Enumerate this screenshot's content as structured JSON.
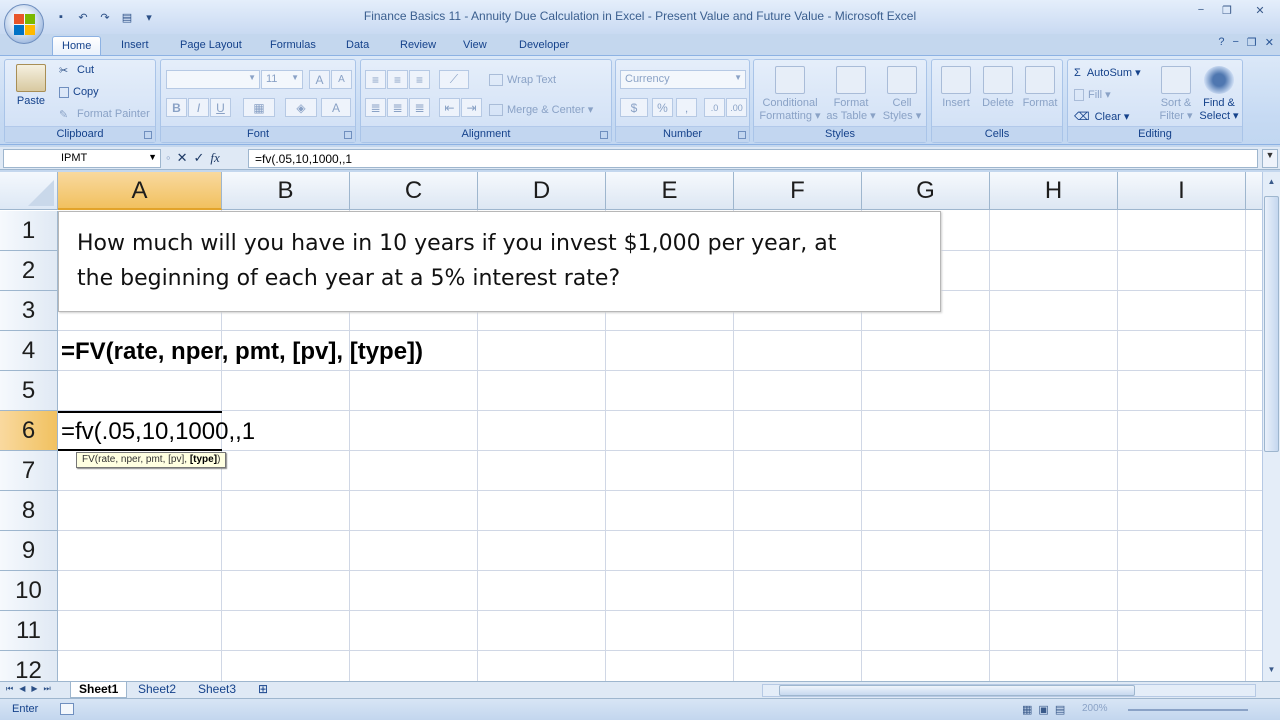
{
  "window": {
    "title": "Finance Basics 11 - Annuity Due Calculation in Excel - Present Value and Future Value - Microsoft Excel",
    "minimize": "−",
    "restore": "❐",
    "close": "✕"
  },
  "qat": [
    "save-icon",
    "undo-icon",
    "redo-icon",
    "print-preview-icon",
    "customize-icon"
  ],
  "tabs": [
    {
      "label": "Home",
      "active": true
    },
    {
      "label": "Insert"
    },
    {
      "label": "Page Layout"
    },
    {
      "label": "Formulas"
    },
    {
      "label": "Data"
    },
    {
      "label": "Review"
    },
    {
      "label": "View"
    },
    {
      "label": "Developer"
    }
  ],
  "ribbon": {
    "clipboard": {
      "label": "Clipboard",
      "paste": "Paste",
      "cut": "Cut",
      "copy": "Copy",
      "format_painter": "Format Painter"
    },
    "font": {
      "label": "Font",
      "font_name": "",
      "font_size": "11",
      "bold": "B",
      "italic": "I",
      "underline": "U",
      "grow": "A",
      "shrink": "A",
      "color": "A"
    },
    "alignment": {
      "label": "Alignment",
      "wrap_text": "Wrap Text",
      "merge_center": "Merge & Center"
    },
    "number": {
      "label": "Number",
      "format": "Currency",
      "dollar": "$",
      "percent": "%",
      "comma": ","
    },
    "styles": {
      "label": "Styles",
      "conditional_1": "Conditional",
      "conditional_2": "Formatting",
      "format_table_1": "Format",
      "format_table_2": "as Table",
      "cell_styles_1": "Cell",
      "cell_styles_2": "Styles"
    },
    "cells": {
      "label": "Cells",
      "insert": "Insert",
      "delete": "Delete",
      "format": "Format"
    },
    "editing": {
      "label": "Editing",
      "autosum": "AutoSum",
      "fill": "Fill",
      "clear": "Clear",
      "sort_1": "Sort &",
      "sort_2": "Filter",
      "find_1": "Find &",
      "find_2": "Select"
    }
  },
  "formula_bar": {
    "name_box": "IPMT",
    "content": "=fv(.05,10,1000,,1"
  },
  "grid": {
    "columns": [
      "A",
      "B",
      "C",
      "D",
      "E",
      "F",
      "G",
      "H",
      "I"
    ],
    "selected_column": "A",
    "rows": [
      "1",
      "2",
      "3",
      "4",
      "5",
      "6",
      "7",
      "8",
      "9",
      "10",
      "11",
      "12"
    ],
    "selected_row": "6",
    "textbox_line1": "How much will you have in 10 years if you invest $1,000 per year, at",
    "textbox_line2": "the beginning of each year at a 5% interest rate?",
    "a4": "=FV(rate, nper, pmt, [pv], [type])",
    "a6": "=fv(.05,10,1000,,1",
    "tooltip_prefix": "FV(rate, nper, pmt, [pv], ",
    "tooltip_bold": "[type]",
    "tooltip_suffix": ")"
  },
  "sheets": [
    {
      "label": "Sheet1",
      "active": true
    },
    {
      "label": "Sheet2"
    },
    {
      "label": "Sheet3"
    }
  ],
  "status": {
    "mode": "Enter",
    "zoom": "200%"
  }
}
